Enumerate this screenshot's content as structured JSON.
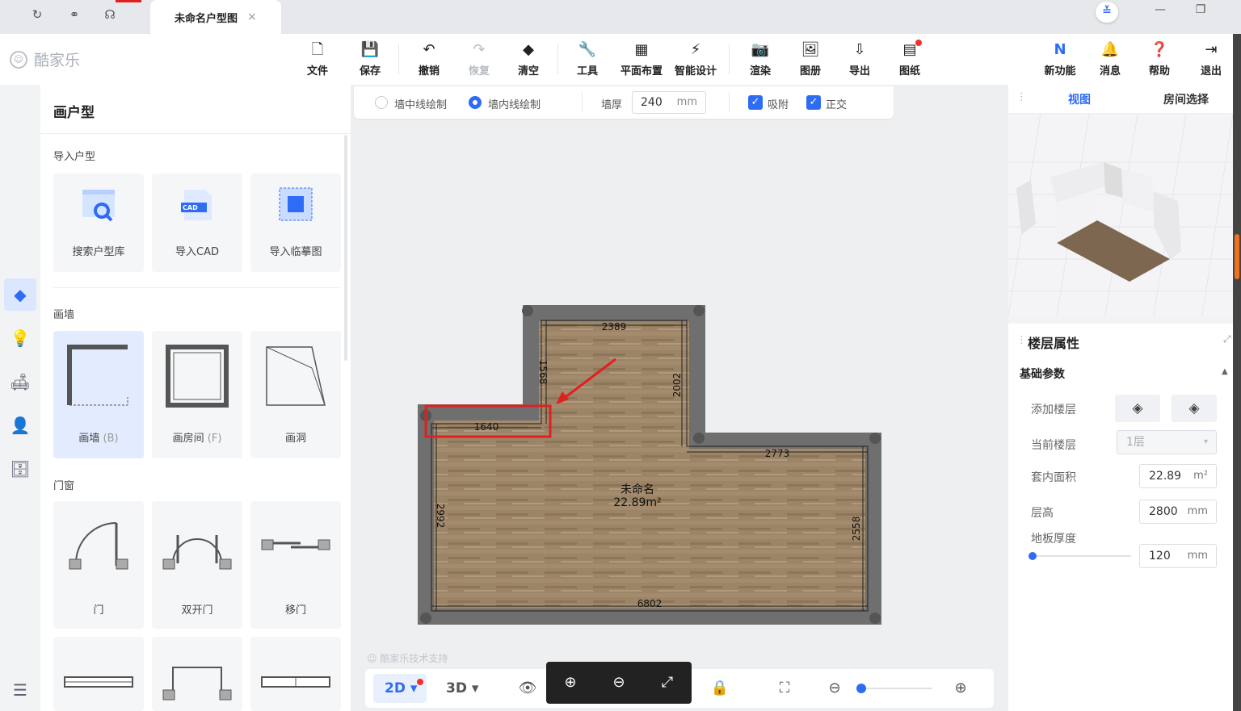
{
  "tabstrip": {
    "doc_tab": "未命名户型图",
    "close": "×",
    "collapse": "≚",
    "minimize": "—",
    "restore": "❐"
  },
  "app": {
    "logo": "酷家乐"
  },
  "toolbar": {
    "file": "文件",
    "save": "保存",
    "undo": "撤销",
    "redo": "恢复",
    "clear": "清空",
    "tools": "工具",
    "layout": "平面布置",
    "smart": "智能设计",
    "render": "渲染",
    "album": "图册",
    "export": "导出",
    "drawing": "图纸",
    "new_features": "新功能",
    "messages": "消息",
    "help": "帮助",
    "logout": "退出"
  },
  "panel": {
    "title": "画户型",
    "import_section": "导入户型",
    "search_lib": "搜索户型库",
    "import_cad": "导入CAD",
    "cad_badge": "CAD",
    "import_trace": "导入临摹图",
    "wall_section": "画墙",
    "draw_wall": "画墙",
    "draw_wall_key": "(B)",
    "draw_room": "画房间",
    "draw_room_key": "(F)",
    "draw_hole": "画洞",
    "doorwin_section": "门窗",
    "door": "门",
    "double_door": "双开门",
    "sliding_door": "移门"
  },
  "drawbar": {
    "center_line": "墙中线绘制",
    "inner_line": "墙内线绘制",
    "wall_thickness_label": "墙厚",
    "wall_thickness": "240",
    "unit": "mm",
    "snap": "吸附",
    "ortho": "正交"
  },
  "floorplan": {
    "room_name": "未命名",
    "room_area": "22.89m²",
    "dims": {
      "top": "2389",
      "left_upper": "1568",
      "right_upper": "2002",
      "step": "1640",
      "right_step": "2773",
      "left": "2992",
      "right": "2558",
      "bottom": "6802"
    }
  },
  "canvas": {
    "tech_support": "酷家乐技术支持"
  },
  "bottombar": {
    "mode_2d": "2D",
    "mode_3d": "3D"
  },
  "right": {
    "tab_view": "视图",
    "tab_room": "房间选择",
    "props_title": "楼层属性",
    "basic": "基础参数",
    "add_floor": "添加楼层",
    "current_floor": "当前楼层",
    "current_floor_value": "1层",
    "inner_area": "套内面积",
    "inner_area_value": "22.89",
    "inner_area_unit": "m²",
    "floor_height": "层高",
    "floor_height_value": "2800",
    "floor_thickness": "地板厚度",
    "floor_thickness_value": "120",
    "unit": "mm"
  }
}
